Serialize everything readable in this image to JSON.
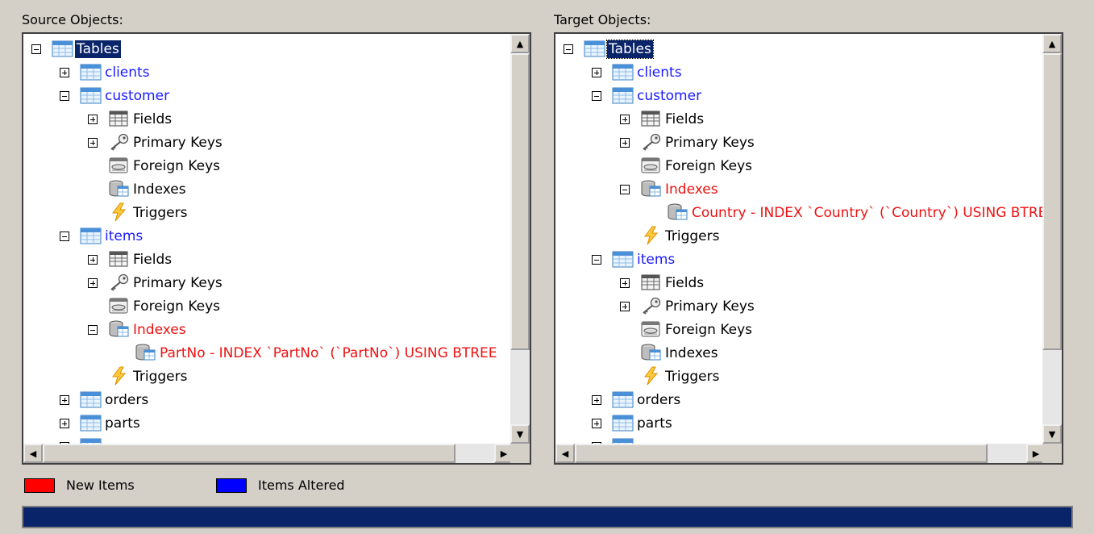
{
  "source": {
    "title": "Source Objects:",
    "rows": [
      {
        "label": "Tables",
        "toggle": "minus",
        "icon": "table-icon",
        "style": "selected",
        "level": 0
      },
      {
        "label": "clients",
        "toggle": "plus",
        "icon": "table-icon",
        "style": "blue",
        "level": 1
      },
      {
        "label": "customer",
        "toggle": "minus",
        "icon": "table-icon",
        "style": "blue",
        "level": 1
      },
      {
        "label": "Fields",
        "toggle": "plus",
        "icon": "fields-icon",
        "style": "",
        "level": 2
      },
      {
        "label": "Primary Keys",
        "toggle": "plus",
        "icon": "key-icon",
        "style": "",
        "level": 2
      },
      {
        "label": "Foreign Keys",
        "toggle": "",
        "icon": "foreign-keys-icon",
        "style": "",
        "level": 2
      },
      {
        "label": "Indexes",
        "toggle": "",
        "icon": "indexes-icon",
        "style": "",
        "level": 2
      },
      {
        "label": "Triggers",
        "toggle": "",
        "icon": "trigger-icon",
        "style": "",
        "level": 2
      },
      {
        "label": "items",
        "toggle": "minus",
        "icon": "table-icon",
        "style": "blue",
        "level": 1
      },
      {
        "label": "Fields",
        "toggle": "plus",
        "icon": "fields-icon",
        "style": "",
        "level": 2
      },
      {
        "label": "Primary Keys",
        "toggle": "plus",
        "icon": "key-icon",
        "style": "",
        "level": 2
      },
      {
        "label": "Foreign Keys",
        "toggle": "",
        "icon": "foreign-keys-icon",
        "style": "",
        "level": 2
      },
      {
        "label": "Indexes",
        "toggle": "minus",
        "icon": "indexes-icon",
        "style": "red",
        "level": 2
      },
      {
        "label": "PartNo - INDEX `PartNo` (`PartNo`) USING BTREE",
        "toggle": "",
        "icon": "indexes-icon",
        "style": "red",
        "level": 3
      },
      {
        "label": "Triggers",
        "toggle": "",
        "icon": "trigger-icon",
        "style": "",
        "level": 2
      },
      {
        "label": "orders",
        "toggle": "plus",
        "icon": "table-icon",
        "style": "",
        "level": 1
      },
      {
        "label": "parts",
        "toggle": "plus",
        "icon": "table-icon",
        "style": "",
        "level": 1
      },
      {
        "label": "",
        "toggle": "plus",
        "icon": "table-icon",
        "style": "",
        "level": 1
      }
    ]
  },
  "target": {
    "title": "Target Objects:",
    "rows": [
      {
        "label": "Tables",
        "toggle": "minus",
        "icon": "table-icon",
        "style": "selected focus",
        "level": 0
      },
      {
        "label": "clients",
        "toggle": "plus",
        "icon": "table-icon",
        "style": "blue",
        "level": 1
      },
      {
        "label": "customer",
        "toggle": "minus",
        "icon": "table-icon",
        "style": "blue",
        "level": 1
      },
      {
        "label": "Fields",
        "toggle": "plus",
        "icon": "fields-icon",
        "style": "",
        "level": 2
      },
      {
        "label": "Primary Keys",
        "toggle": "plus",
        "icon": "key-icon",
        "style": "",
        "level": 2
      },
      {
        "label": "Foreign Keys",
        "toggle": "",
        "icon": "foreign-keys-icon",
        "style": "",
        "level": 2
      },
      {
        "label": "Indexes",
        "toggle": "minus",
        "icon": "indexes-icon",
        "style": "red",
        "level": 2
      },
      {
        "label": "Country - INDEX `Country` (`Country`) USING BTREE",
        "toggle": "",
        "icon": "indexes-icon",
        "style": "red",
        "level": 3
      },
      {
        "label": "Triggers",
        "toggle": "",
        "icon": "trigger-icon",
        "style": "",
        "level": 2
      },
      {
        "label": "items",
        "toggle": "minus",
        "icon": "table-icon",
        "style": "blue",
        "level": 1
      },
      {
        "label": "Fields",
        "toggle": "plus",
        "icon": "fields-icon",
        "style": "",
        "level": 2
      },
      {
        "label": "Primary Keys",
        "toggle": "plus",
        "icon": "key-icon",
        "style": "",
        "level": 2
      },
      {
        "label": "Foreign Keys",
        "toggle": "",
        "icon": "foreign-keys-icon",
        "style": "",
        "level": 2
      },
      {
        "label": "Indexes",
        "toggle": "",
        "icon": "indexes-icon",
        "style": "",
        "level": 2
      },
      {
        "label": "Triggers",
        "toggle": "",
        "icon": "trigger-icon",
        "style": "",
        "level": 2
      },
      {
        "label": "orders",
        "toggle": "plus",
        "icon": "table-icon",
        "style": "",
        "level": 1
      },
      {
        "label": "parts",
        "toggle": "plus",
        "icon": "table-icon",
        "style": "",
        "level": 1
      },
      {
        "label": "",
        "toggle": "plus",
        "icon": "table-icon",
        "style": "",
        "level": 1
      }
    ]
  },
  "legend": {
    "new_items": {
      "label": "New Items",
      "color": "#ff0000"
    },
    "items_altered": {
      "label": "Items Altered",
      "color": "#0000ff"
    }
  },
  "progress": {
    "fraction": 1.0,
    "color": "#0a246a"
  },
  "colors": {
    "selection": "#0a246a",
    "altered": "#1a1aff",
    "new": "#ee1111"
  }
}
